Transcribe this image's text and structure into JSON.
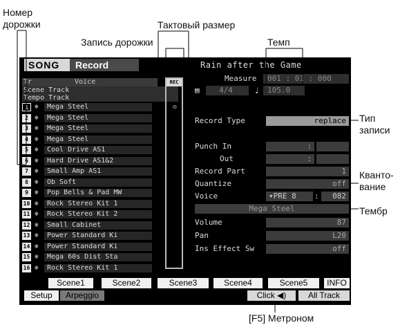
{
  "annotations": {
    "track_number": [
      "Номер",
      "дорожки"
    ],
    "time_signature": "Тактовый размер",
    "track_record": "Запись дорожки",
    "tempo": "Темп",
    "record_type": [
      "Тип",
      "записи"
    ],
    "quantize": [
      "Кванто-",
      "вание"
    ],
    "timbre": "Тембр",
    "metronome": "[F5] Метроном"
  },
  "header": {
    "song_tab": "SONG",
    "mode_tab": "Record",
    "song_name": "Rain after the Game"
  },
  "columns": {
    "tr": "Tr",
    "voice": "Voice",
    "rec": "REC TR"
  },
  "scene_track": "Scene Track",
  "tempo_track": "Tempo Track",
  "tracks": [
    {
      "num": "1",
      "voice": "Mega Steel",
      "rec": "◎",
      "selected": true
    },
    {
      "num": "2",
      "voice": "Mega Steel",
      "rec": ""
    },
    {
      "num": "3",
      "voice": "Mega Steel",
      "rec": ""
    },
    {
      "num": "4",
      "voice": "Mega Steel",
      "rec": ""
    },
    {
      "num": "5",
      "voice": "Cool Drive AS1",
      "rec": ""
    },
    {
      "num": "6",
      "voice": "Hard Drive AS1&2",
      "rec": ""
    },
    {
      "num": "7",
      "voice": "Small Amp AS1",
      "rec": ""
    },
    {
      "num": "8",
      "voice": "Ob Soft",
      "rec": ""
    },
    {
      "num": "9",
      "voice": "Pop Bells & Pad MW",
      "rec": ""
    },
    {
      "num": "10",
      "voice": "Rock Stereo Kit 1",
      "rec": ""
    },
    {
      "num": "11",
      "voice": "Rock Stereo Kit 2",
      "rec": ""
    },
    {
      "num": "12",
      "voice": "Small Cabinet",
      "rec": ""
    },
    {
      "num": "13",
      "voice": "Power Standard Ki",
      "rec": ""
    },
    {
      "num": "14",
      "voice": "Power Standard Ki",
      "rec": ""
    },
    {
      "num": "15",
      "voice": "Mega 60s Dist Sta",
      "rec": ""
    },
    {
      "num": "16",
      "voice": "Rock Stereo Kit 1",
      "rec": ""
    }
  ],
  "measure": {
    "label": "Measure",
    "value": "001 : 01 : 000"
  },
  "time_sig": {
    "icon": "time-signature-icon",
    "value": "4/4"
  },
  "tempo": {
    "icon": "quarter-note-icon",
    "value": "105.0"
  },
  "params": {
    "record_type": {
      "label": "Record Type",
      "value": "replace"
    },
    "punch_in": {
      "label": "Punch In",
      "value": ":"
    },
    "punch_out": {
      "label": "Out",
      "value": ":"
    },
    "record_part": {
      "label": "Record Part",
      "value": "1"
    },
    "quantize": {
      "label": "Quantize",
      "value": "off"
    },
    "voice": {
      "label": "Voice",
      "bank": "▾PRE 8",
      "sep": ":",
      "number": "082",
      "name": "Mega Steel"
    },
    "volume": {
      "label": "Volume",
      "value": "87"
    },
    "pan": {
      "label": "Pan",
      "value": "L20"
    },
    "ins_effect": {
      "label": "Ins Effect Sw",
      "value": "off"
    }
  },
  "scene_buttons": [
    "Scene1",
    "Scene2",
    "Scene3",
    "Scene4",
    "Scene5",
    "INFO"
  ],
  "bottom": {
    "setup": "Setup",
    "arpeggio": "Arpeggio",
    "click": "Click ◀)",
    "all_track": "All Track"
  }
}
